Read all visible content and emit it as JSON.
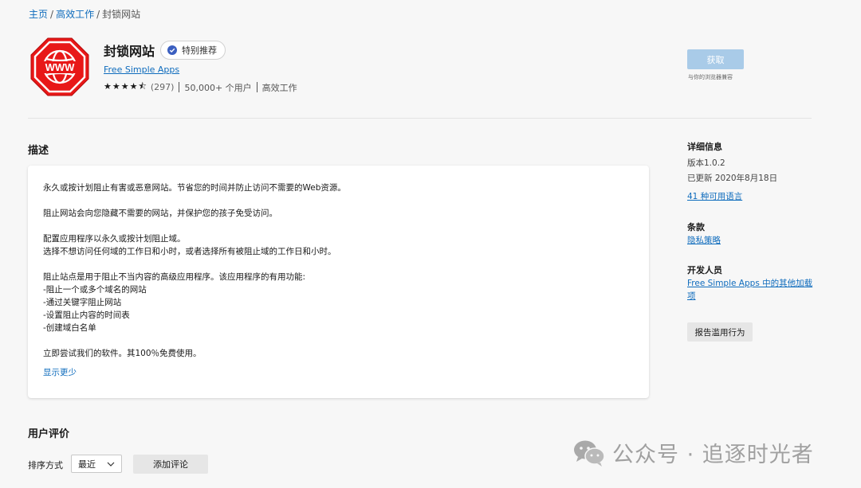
{
  "breadcrumb": {
    "home": "主页",
    "category": "高效工作",
    "current": "封锁网站",
    "separator": "/"
  },
  "app": {
    "title": "封锁网站",
    "badge": "特别推荐",
    "publisher": "Free Simple Apps",
    "stars": "★★★★⯪",
    "rating_value": 4.5,
    "rating_count": "(297)",
    "users": "50,000+ 个用户",
    "category": "高效工作",
    "logo_text": "WWW",
    "logo_color": "#e81818"
  },
  "get": {
    "label": "获取",
    "caption": "与你的浏览器兼容",
    "color": "#a9cbe8"
  },
  "description": {
    "heading": "描述",
    "paragraphs": [
      "永久或按计划阻止有害或恶意网站。节省您的时间并防止访问不需要的Web资源。",
      "阻止网站会向您隐藏不需要的网站，并保护您的孩子免受访问。",
      "配置应用程序以永久或按计划阻止域。\n选择不想访问任何域的工作日和小时，或者选择所有被阻止域的工作日和小时。",
      "阻止站点是用于阻止不当内容的高级应用程序。该应用程序的有用功能:\n-阻止一个或多个域名的网站\n-通过关键字阻止网站\n-设置阻止内容的时间表\n-创建域白名单",
      "立即尝试我们的软件。其100％免费使用。"
    ],
    "show_less": "显示更少"
  },
  "details": {
    "heading": "详细信息",
    "version": "版本1.0.2",
    "updated": "已更新 2020年8月18日",
    "languages": "41 种可用语言"
  },
  "terms": {
    "heading": "条款",
    "privacy": "隐私策略"
  },
  "developer": {
    "heading": "开发人员",
    "more_apps_line1": "Free Simple Apps 中的其他加载",
    "more_apps_line2": "项",
    "report": "报告滥用行为"
  },
  "reviews": {
    "heading": "用户评价",
    "sort_label": "排序方式",
    "sort_value": "最近",
    "add_review": "添加评论"
  },
  "watermark": {
    "text": "公众号 · 追逐时光者"
  }
}
